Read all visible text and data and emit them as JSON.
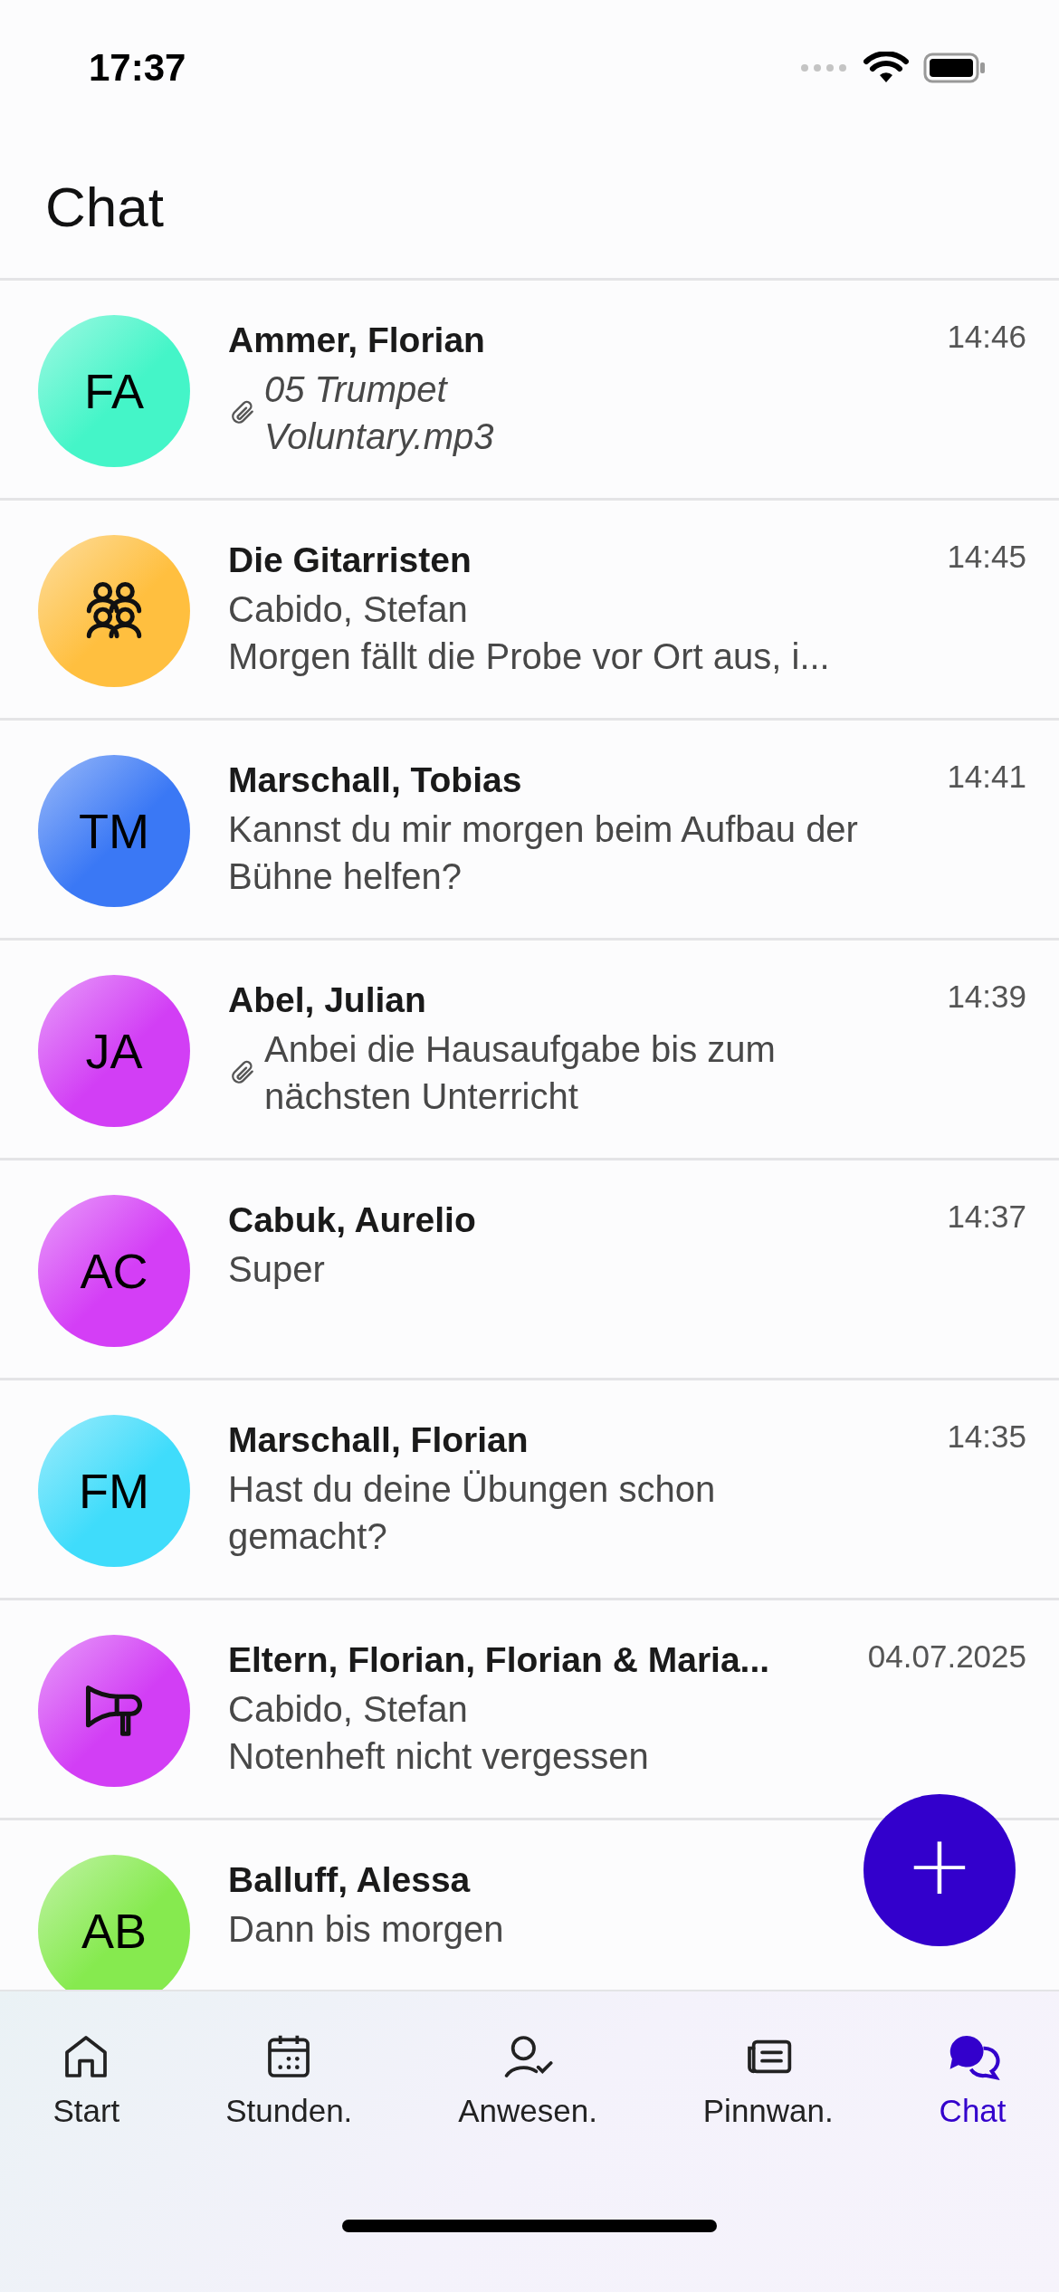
{
  "status_bar": {
    "time": "17:37"
  },
  "header": {
    "title": "Chat"
  },
  "chats": [
    {
      "avatar": {
        "kind": "initials",
        "initials": "FA",
        "color": "#44f5c8"
      },
      "name": "Ammer, Florian",
      "time": "14:46",
      "message": {
        "kind": "file",
        "text": "05 Trumpet Voluntary.mp3"
      }
    },
    {
      "avatar": {
        "kind": "group",
        "color": "#ffbf3f"
      },
      "name": "Die Gitarristen",
      "time": "14:45",
      "sender": "Cabido, Stefan",
      "message": {
        "kind": "text",
        "text": "Morgen fällt die Probe vor Ort aus, i..."
      }
    },
    {
      "avatar": {
        "kind": "initials",
        "initials": "TM",
        "color": "#3a78f5"
      },
      "name": "Marschall, Tobias",
      "time": "14:41",
      "message": {
        "kind": "text",
        "text": "Kannst du mir morgen beim Aufbau der Bühne helfen?"
      }
    },
    {
      "avatar": {
        "kind": "initials",
        "initials": "JA",
        "color": "#d23ef5"
      },
      "name": "Abel, Julian",
      "time": "14:39",
      "message": {
        "kind": "attachment",
        "text": "Anbei die Hausaufgabe bis zum nächsten Unterricht"
      }
    },
    {
      "avatar": {
        "kind": "initials",
        "initials": "AC",
        "color": "#d43ef6"
      },
      "name": "Cabuk, Aurelio",
      "time": "14:37",
      "message": {
        "kind": "text",
        "text": "Super"
      }
    },
    {
      "avatar": {
        "kind": "initials",
        "initials": "FM",
        "color": "#3fdcfb"
      },
      "name": "Marschall, Florian",
      "time": "14:35",
      "message": {
        "kind": "text",
        "text": "Hast du deine Übungen schon gemacht?"
      }
    },
    {
      "avatar": {
        "kind": "announcement",
        "color": "#d23ef5"
      },
      "name": "Eltern, Florian, Florian & Maria...",
      "time": "04.07.2025",
      "sender": "Cabido, Stefan",
      "message": {
        "kind": "text",
        "text": "Notenheft nicht vergessen"
      }
    },
    {
      "avatar": {
        "kind": "initials",
        "initials": "AB",
        "color": "#86ea4f"
      },
      "name": "Balluff, Alessa",
      "message": {
        "kind": "text",
        "text": "Dann bis morgen"
      }
    }
  ],
  "fab": {
    "label": "+"
  },
  "tabs": [
    {
      "label": "Start",
      "selected": false
    },
    {
      "label": "Stunden.",
      "selected": false
    },
    {
      "label": "Anwesen.",
      "selected": false
    },
    {
      "label": "Pinnwan.",
      "selected": false
    },
    {
      "label": "Chat",
      "selected": true
    }
  ]
}
